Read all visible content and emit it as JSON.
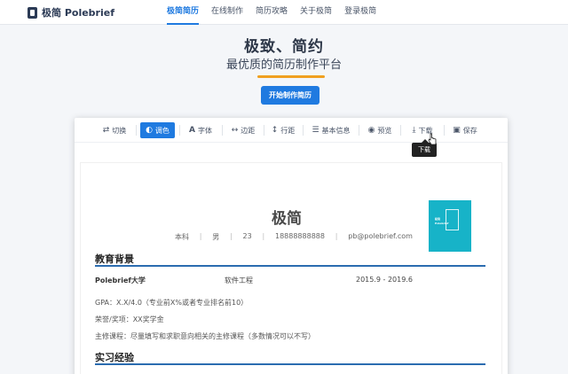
{
  "nav": {
    "logo_text": "极简 Polebrief",
    "links": [
      "极简简历",
      "在线制作",
      "简历攻略",
      "关于极简",
      "登录极简"
    ]
  },
  "hero": {
    "title": "极致、简约",
    "subtitle": "最优质的简历制作平台",
    "cta_label": "开始制作简历"
  },
  "toolbar": {
    "items": [
      {
        "label": "切换",
        "icon": "swap-icon"
      },
      {
        "label": "调色",
        "icon": "palette-icon",
        "active": true
      },
      {
        "label": "字体",
        "icon": "font-icon"
      },
      {
        "label": "边距",
        "icon": "margin-icon"
      },
      {
        "label": "行距",
        "icon": "line-height-icon"
      },
      {
        "label": "基本信息",
        "icon": "list-icon"
      },
      {
        "label": "预览",
        "icon": "eye-icon"
      },
      {
        "label": "下载",
        "icon": "download-icon"
      },
      {
        "label": "保存",
        "icon": "save-icon"
      }
    ],
    "tooltip": "下载"
  },
  "resume": {
    "name": "极简",
    "info": [
      "本科",
      "男",
      "23",
      "18888888888",
      "pb@polebrief.com"
    ],
    "education": {
      "title": "教育背景",
      "school": "Polebrief大学",
      "major": "软件工程",
      "time": "2015.9 - 2019.6",
      "gpa": "GPA：X.X/4.0（专业前X%或者专业排名前10）",
      "honors": "荣誉/奖项：XX奖学金",
      "courses": "主修课程：尽量填写和求职意向相关的主修课程（多数情况可以不写）"
    },
    "internship": {
      "title": "实习经验"
    }
  },
  "colors": {
    "accent": "#1f7ae0",
    "underline": "#f0a020",
    "section_line": "#2b6cb0"
  }
}
